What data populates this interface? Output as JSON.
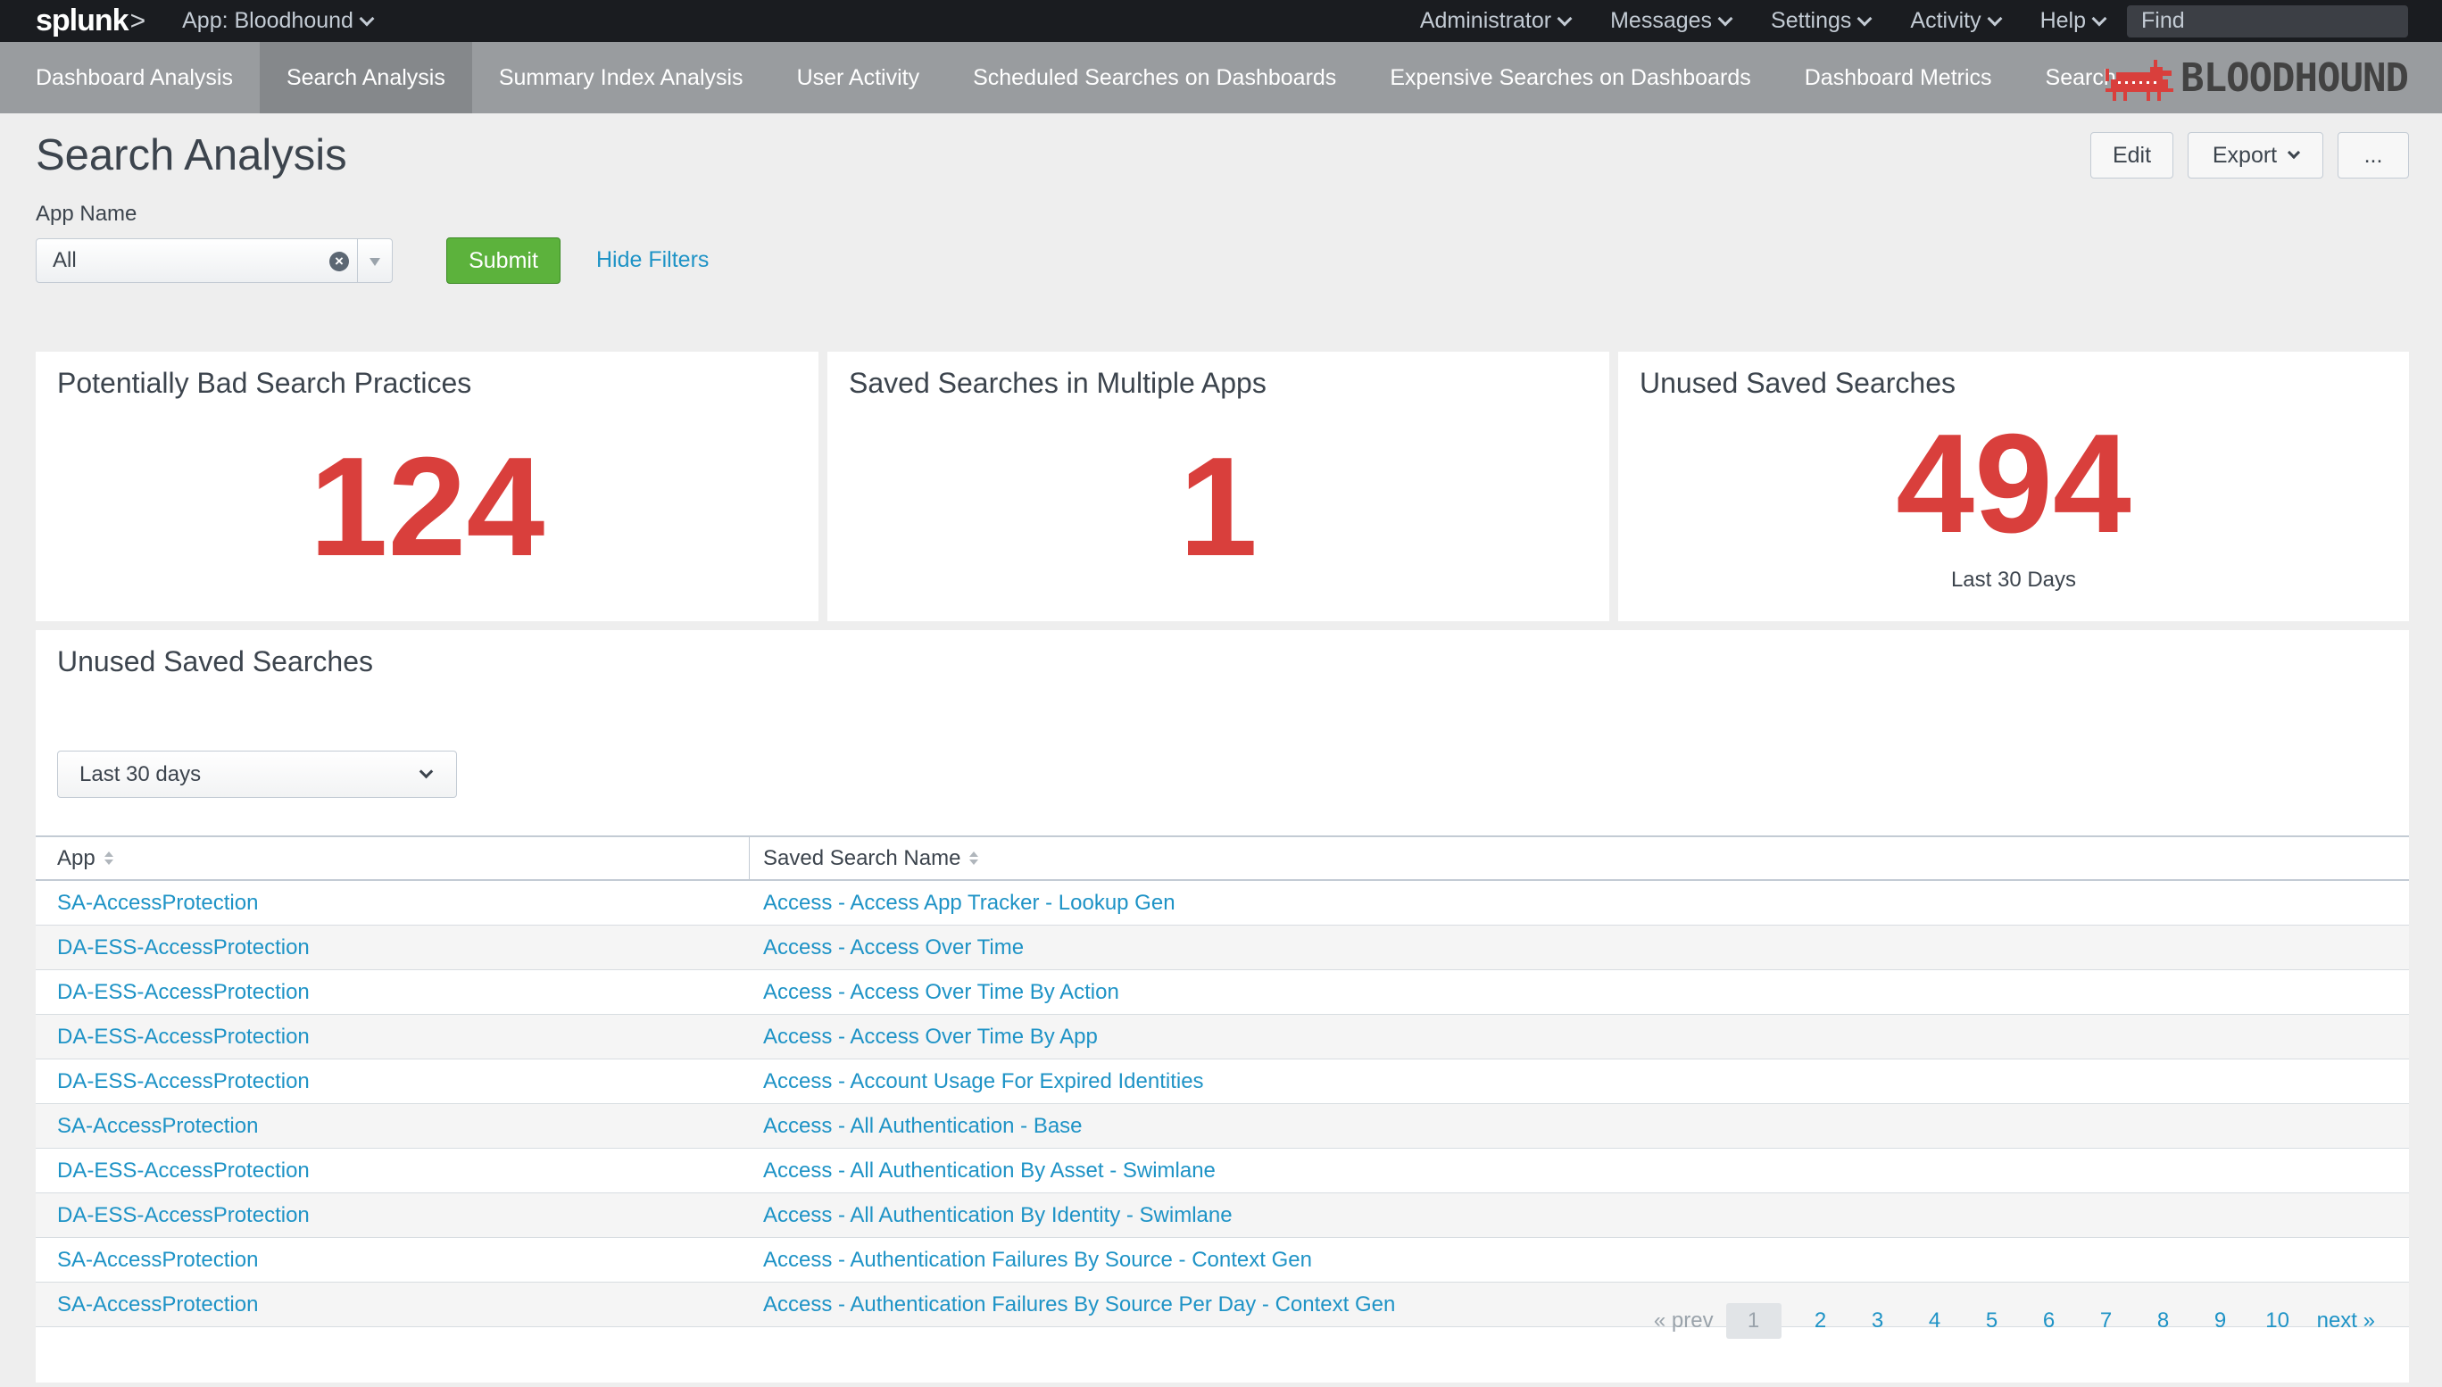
{
  "topbar": {
    "logo": "splunk",
    "logo_suffix": ">",
    "app_menu": "App: Bloodhound",
    "menus": [
      "Administrator",
      "Messages",
      "Settings",
      "Activity",
      "Help"
    ],
    "find_placeholder": "Find"
  },
  "nav": {
    "items": [
      "Dashboard Analysis",
      "Search Analysis",
      "Summary Index Analysis",
      "User Activity",
      "Scheduled Searches on Dashboards",
      "Expensive Searches on Dashboards",
      "Dashboard Metrics",
      "Search"
    ],
    "active": "Search Analysis",
    "brand_text": "BLOODHOUND",
    "brand_color": "#d93f3c"
  },
  "header": {
    "title": "Search Analysis",
    "edit_label": "Edit",
    "export_label": "Export",
    "more_label": "..."
  },
  "filters": {
    "app_name_label": "App Name",
    "app_name_value": "All",
    "submit_label": "Submit",
    "hide_filters_label": "Hide Filters"
  },
  "single_values": [
    {
      "title": "Potentially Bad Search Practices",
      "value": "124",
      "under": ""
    },
    {
      "title": "Saved Searches in Multiple Apps",
      "value": "1",
      "under": ""
    },
    {
      "title": "Unused Saved Searches",
      "value": "494",
      "under": "Last 30 Days"
    }
  ],
  "colors": {
    "value_red": "#d93f3c",
    "link_blue": "#1e93c6",
    "submit_green": "#5cb23c"
  },
  "table_panel": {
    "title": "Unused Saved Searches",
    "time_range": "Last 30 days",
    "columns": [
      "App",
      "Saved Search Name"
    ],
    "rows": [
      [
        "SA-AccessProtection",
        "Access - Access App Tracker - Lookup Gen"
      ],
      [
        "DA-ESS-AccessProtection",
        "Access - Access Over Time"
      ],
      [
        "DA-ESS-AccessProtection",
        "Access - Access Over Time By Action"
      ],
      [
        "DA-ESS-AccessProtection",
        "Access - Access Over Time By App"
      ],
      [
        "DA-ESS-AccessProtection",
        "Access - Account Usage For Expired Identities"
      ],
      [
        "SA-AccessProtection",
        "Access - All Authentication - Base"
      ],
      [
        "DA-ESS-AccessProtection",
        "Access - All Authentication By Asset - Swimlane"
      ],
      [
        "DA-ESS-AccessProtection",
        "Access - All Authentication By Identity - Swimlane"
      ],
      [
        "SA-AccessProtection",
        "Access - Authentication Failures By Source - Context Gen"
      ],
      [
        "SA-AccessProtection",
        "Access - Authentication Failures By Source Per Day - Context Gen"
      ]
    ],
    "pagination": {
      "prev": "« prev",
      "pages": [
        "1",
        "2",
        "3",
        "4",
        "5",
        "6",
        "7",
        "8",
        "9",
        "10"
      ],
      "current": "1",
      "next": "next »"
    }
  }
}
